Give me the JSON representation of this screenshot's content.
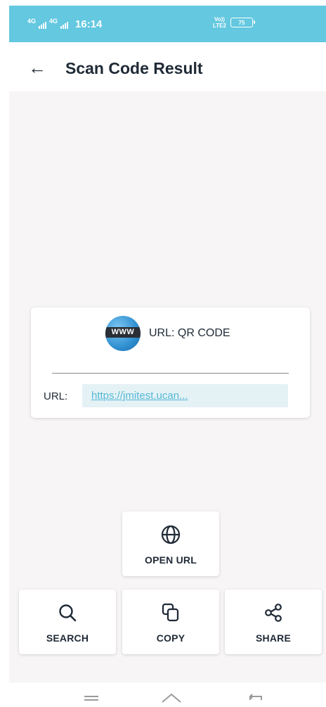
{
  "status_bar": {
    "network_1": "4G",
    "network_2": "4G",
    "time": "16:14",
    "volte_top": "Vo))",
    "volte_bottom": "LTE2",
    "battery": "75"
  },
  "app_bar": {
    "back_symbol": "←",
    "title": "Scan Code Result"
  },
  "result_card": {
    "icon_text": "WWW",
    "title": "URL: QR CODE",
    "url_label": "URL:",
    "url_value": "https://jmitest.ucan..."
  },
  "actions": {
    "open_url": "OPEN URL",
    "search": "SEARCH",
    "copy": "COPY",
    "share": "SHARE"
  },
  "colors": {
    "status_bar": "#63c8e0",
    "link": "#55b8d4",
    "url_box": "#e4f2f6",
    "content_bg": "#f7f5f5"
  }
}
